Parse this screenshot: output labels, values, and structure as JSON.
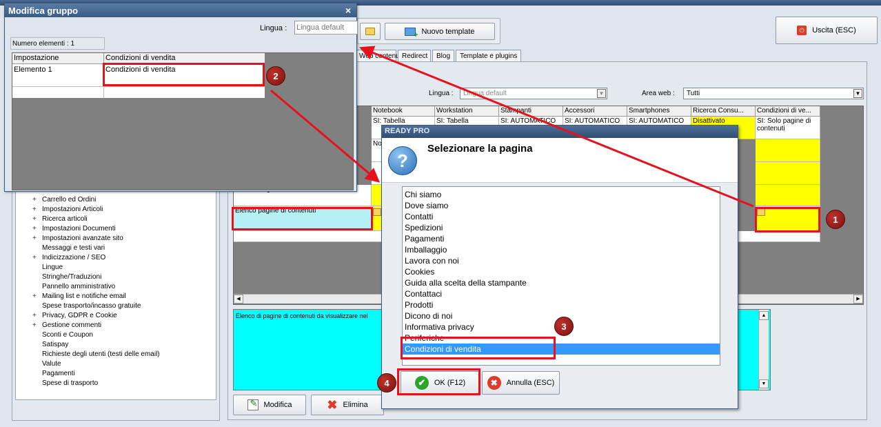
{
  "toolbar": {
    "nuovo_template_label": "Nuovo template",
    "uscita_label": "Uscita (ESC)"
  },
  "tabs": [
    {
      "label": "Web contenuti"
    },
    {
      "label": "Redirect"
    },
    {
      "label": "Blog"
    },
    {
      "label": "Template e plugins"
    }
  ],
  "filters": {
    "lingua_label": "Lingua :",
    "lingua_value": "Lingua default",
    "area_label": "Area web :",
    "area_value": "Tutti"
  },
  "grid": {
    "headers": [
      "Notebook",
      "Workstation",
      "Stampanti",
      "Accessori",
      "Smartphones",
      "Ricerca Consu...",
      "Condizioni di ve..."
    ],
    "row1": [
      "SI: Tabella",
      "SI: Tabella",
      "SI: AUTOMATICO",
      "SI: AUTOMATICO",
      "SI: AUTOMATICO",
      "Disattivato",
      "SI: Solo pagine di contenuti"
    ],
    "row2_notebook": "No",
    "link_label": "Link immagine",
    "elenco_label": "Elenco pagine di contenuti"
  },
  "tree": {
    "items": [
      {
        "label": "Carrello ed Ordini",
        "expand": true
      },
      {
        "label": "Impostazioni Articoli",
        "expand": true
      },
      {
        "label": "Ricerca articoli",
        "expand": true
      },
      {
        "label": "Impostazioni Documenti",
        "expand": true
      },
      {
        "label": "Impostazioni avanzate sito",
        "expand": true
      },
      {
        "label": "Messaggi e testi vari",
        "expand": false
      },
      {
        "label": "Indicizzazione / SEO",
        "expand": true
      },
      {
        "label": "Lingue",
        "expand": false
      },
      {
        "label": "Stringhe/Traduzioni",
        "expand": false
      },
      {
        "label": "Pannello amministrativo",
        "expand": false
      },
      {
        "label": "Mailing list e notifiche email",
        "expand": true
      },
      {
        "label": "Spese trasporto/incasso gratuite",
        "expand": false
      },
      {
        "label": "Privacy, GDPR e Cookie",
        "expand": true
      },
      {
        "label": "Gestione commenti",
        "expand": true
      },
      {
        "label": "Sconti e Coupon",
        "expand": false
      },
      {
        "label": "Satispay",
        "expand": false
      },
      {
        "label": "Richieste degli utenti (testi delle email)",
        "expand": false
      },
      {
        "label": "Valute",
        "expand": false
      },
      {
        "label": "Pagamenti",
        "expand": false
      },
      {
        "label": "Spese di trasporto",
        "expand": false
      }
    ]
  },
  "description": "Elenco di pagine di contenuti da visualizzare nel",
  "bottom_buttons": {
    "modifica": "Modifica",
    "elimina": "Elimina"
  },
  "dialog_mg": {
    "title": "Modifica gruppo",
    "lingua_label": "Lingua :",
    "lingua_placeholder": "Lingua default",
    "count": "Numero elementi : 1",
    "col1": "Impostazione",
    "col2": "Condizioni di vendita",
    "row_label": "Elemento 1",
    "row_value": "Condizioni di vendita",
    "close": "×"
  },
  "dialog_rp": {
    "title": "READY PRO",
    "heading": "Selezionare la pagina",
    "items": [
      "Chi siamo",
      "Dove siamo",
      "Contatti",
      "Spedizioni",
      "Pagamenti",
      "Imballaggio",
      "Lavora con noi",
      "Cookies",
      "Guida alla scelta della stampante",
      "Contattaci",
      "Prodotti",
      "Dicono di noi",
      "Informativa privacy",
      "Periferiche",
      "Condizioni di vendita"
    ],
    "selected_index": 14,
    "ok_label": "OK (F12)",
    "annulla_label": "Annulla (ESC)"
  },
  "annotations": [
    "1",
    "2",
    "3",
    "4"
  ],
  "colors": {
    "accent_red": "#e8101a",
    "highlight_yellow": "#ffff00",
    "selection_blue": "#3399ff"
  }
}
